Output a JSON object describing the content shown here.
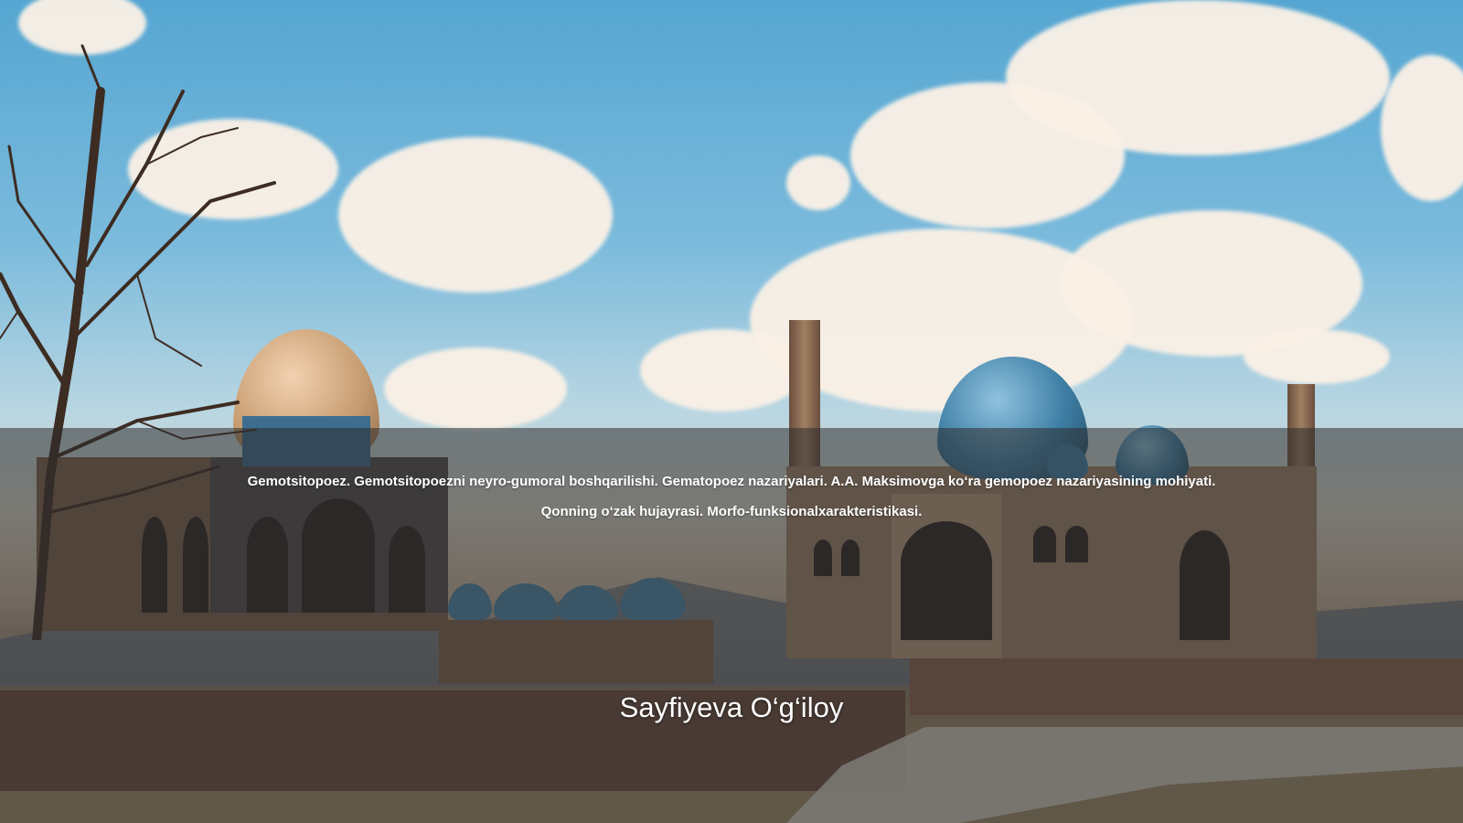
{
  "slide": {
    "subtitle_line_1": "Gemotsitopoez. Gemotsitopoezni neyro-gumoral boshqarilishi. Gematopoez nazariyalari. A.A. Maksimovga ko‘ra gemopoez nazariyasining mohiyati.",
    "subtitle_line_2": "Qonning o‘zak hujayrasi. Morfo-funksionalxarakteristikasi.",
    "author": "Sayfiyeva O‘g‘iloy"
  },
  "background": {
    "scene": "mosque-landscape-image",
    "colors": {
      "sky": "#55a6d2",
      "cloud": "#fbf1e6",
      "dome_blue": "#3f7fa6",
      "dome_gold": "#c49a6e",
      "brick": "#8a6b52",
      "overlay": "rgba(45,45,45,0.55)"
    }
  }
}
